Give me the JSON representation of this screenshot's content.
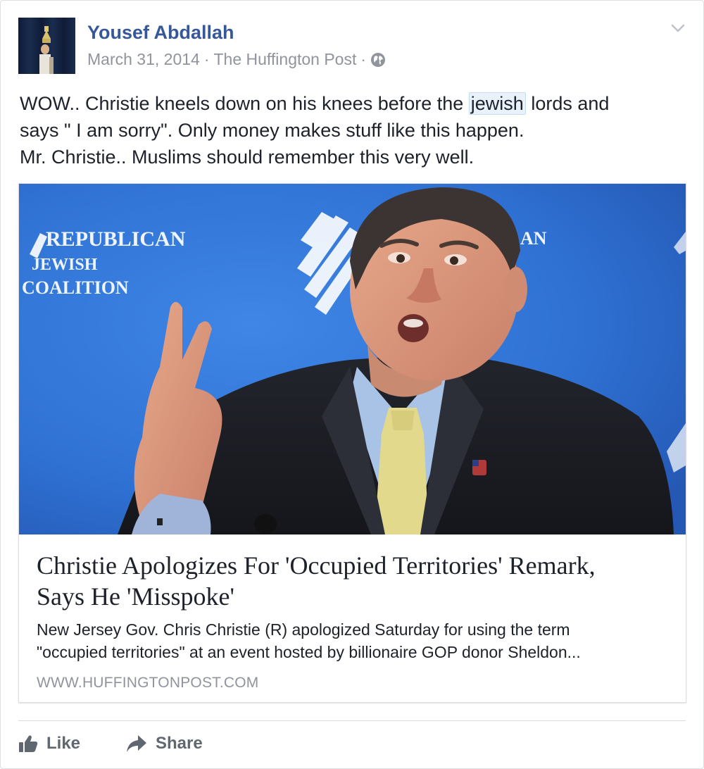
{
  "post": {
    "author": "Yousef Abdallah",
    "date": "March 31, 2014",
    "separator": "·",
    "source": "The Huffington Post",
    "privacy_icon": "globe-icon",
    "options_icon": "chevron-down-icon",
    "text": {
      "line1_before": "WOW.. Christie kneels down on his knees before the ",
      "line1_highlight": "jewish",
      "line1_after": " lords and",
      "line2": "says \" I am sorry\". Only money makes stuff like this happen.",
      "line3": "Mr. Christie.. Muslims should remember this very well."
    }
  },
  "link_preview": {
    "image_backdrop_text": [
      "REPUBLICAN",
      "JEWISH",
      "COALITION"
    ],
    "image_backdrop_partial": "AN",
    "title_line1": "Christie Apologizes For 'Occupied Territories' Remark,",
    "title_line2": "Says He 'Misspoke'",
    "description_line1": "New Jersey Gov. Chris Christie (R) apologized Saturday for using the term",
    "description_line2": "\"occupied territories\" at an event hosted by billionaire GOP donor Sheldon...",
    "domain": "WWW.HUFFINGTONPOST.COM"
  },
  "actions": {
    "like_label": "Like",
    "like_icon": "thumbs-up-icon",
    "share_label": "Share",
    "share_icon": "share-arrow-icon"
  },
  "colors": {
    "author_link": "#365899",
    "meta_text": "#90949c",
    "body_text": "#1d2129",
    "action_text": "#606770",
    "image_background": "#2d6fd0"
  }
}
